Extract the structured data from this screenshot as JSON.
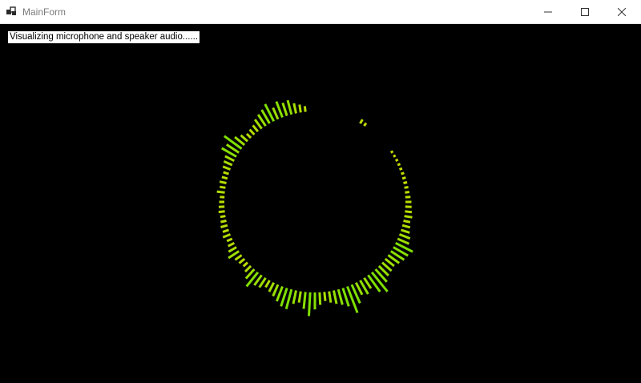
{
  "window": {
    "title": "MainForm"
  },
  "status": {
    "text": "Visualizing microphone and speaker audio......"
  },
  "icons": {
    "app": "app-form-icon",
    "minimize": "minimize-icon",
    "maximize": "maximize-icon",
    "close": "close-icon"
  },
  "visualizer": {
    "type": "circular-spectrum",
    "bar_count": 120,
    "color_low": "#c8dc00",
    "color_high": "#7ee000",
    "magnitudes": [
      0.32,
      0.25,
      0.18,
      0.15,
      0.12,
      0.1,
      0.08,
      0.05,
      0.04,
      0.03,
      0.02,
      0.01,
      0,
      0,
      0,
      0,
      0,
      0,
      0,
      0.1,
      0.2,
      0,
      0,
      0,
      0,
      0,
      0,
      0,
      0,
      0,
      0,
      0,
      0.3,
      0.5,
      0.7,
      1.1,
      1.0,
      1.3,
      0.9,
      1.5,
      1.2,
      1.0,
      0.8,
      0.5,
      0.4,
      0.3,
      0.6,
      0.9,
      1.7,
      1.1,
      1.3,
      0.7,
      0.6,
      0.5,
      0.3,
      0.3,
      0.4,
      0.3,
      0.5,
      0.2,
      0.25,
      0.3,
      0.35,
      0.25,
      0.3,
      0.4,
      0.35,
      0.5,
      0.3,
      0.4,
      0.6,
      0.9,
      0.5,
      0.4,
      0.3,
      0.5,
      0.9,
      1.4,
      0.9,
      0.8,
      0.5,
      0.7,
      0.9,
      1.2,
      1.5,
      1.6,
      1.0,
      0.8,
      1.3,
      1.9,
      1.3,
      0.9,
      0.6,
      0.8,
      1.0,
      1.2,
      1.5,
      2.3,
      1.6,
      1.0,
      1.2,
      0.9,
      1.6,
      2.0,
      1.3,
      1.0,
      0.9,
      0.8,
      1.0,
      1.2,
      1.3,
      1.5,
      0.9,
      0.8,
      0.6,
      0.5,
      0.4,
      0.5,
      0.4,
      0.35
    ]
  }
}
